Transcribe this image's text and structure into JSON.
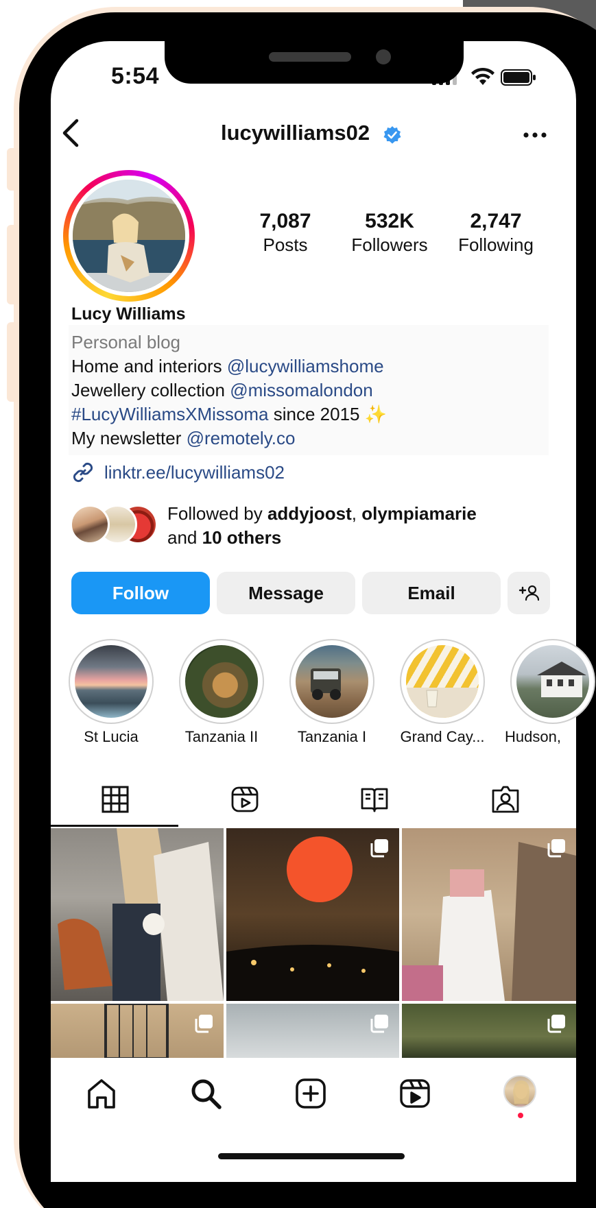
{
  "status_bar": {
    "time": "5:54"
  },
  "header": {
    "username": "lucywilliams02"
  },
  "profile": {
    "stats": [
      {
        "value": "7,087",
        "label": "Posts"
      },
      {
        "value": "532K",
        "label": "Followers"
      },
      {
        "value": "2,747",
        "label": "Following"
      }
    ],
    "name": "Lucy Williams",
    "category": "Personal blog",
    "bio": {
      "line1_text": "Home and interiors ",
      "line1_mention": "@lucywilliamshome",
      "line2_text": "Jewellery collection ",
      "line2_mention": "@missomalondon",
      "line3_hashtag": "#LucyWilliamsXMissoma",
      "line3_text": " since 2015 ",
      "line3_emoji": "✨",
      "line4_text": "My newsletter ",
      "line4_mention": "@remotely.co"
    },
    "link": "linktr.ee/lucywilliams02",
    "followed_by": {
      "prefix": "Followed by ",
      "user1": "addyjoost",
      "separator": ", ",
      "user2": "olympiamarie",
      "and_text": "and ",
      "others": "10 others"
    }
  },
  "actions": {
    "follow": "Follow",
    "message": "Message",
    "email": "Email"
  },
  "highlights": [
    {
      "label": "St Lucia"
    },
    {
      "label": "Tanzania II"
    },
    {
      "label": "Tanzania I"
    },
    {
      "label": "Grand Cay..."
    },
    {
      "label": "Hudson,"
    }
  ],
  "colors": {
    "follow_button": "#1a97f5",
    "link": "#2a4a86",
    "verified": "#3897f0",
    "notification_dot": "#ff1744"
  },
  "icons": {
    "header": [
      "back-icon",
      "verified-icon",
      "more-icon"
    ],
    "tabs": [
      "grid-icon",
      "reels-icon",
      "guides-icon",
      "tagged-icon"
    ],
    "nav": [
      "home-icon",
      "search-icon",
      "create-icon",
      "reels-icon",
      "profile-avatar"
    ]
  }
}
